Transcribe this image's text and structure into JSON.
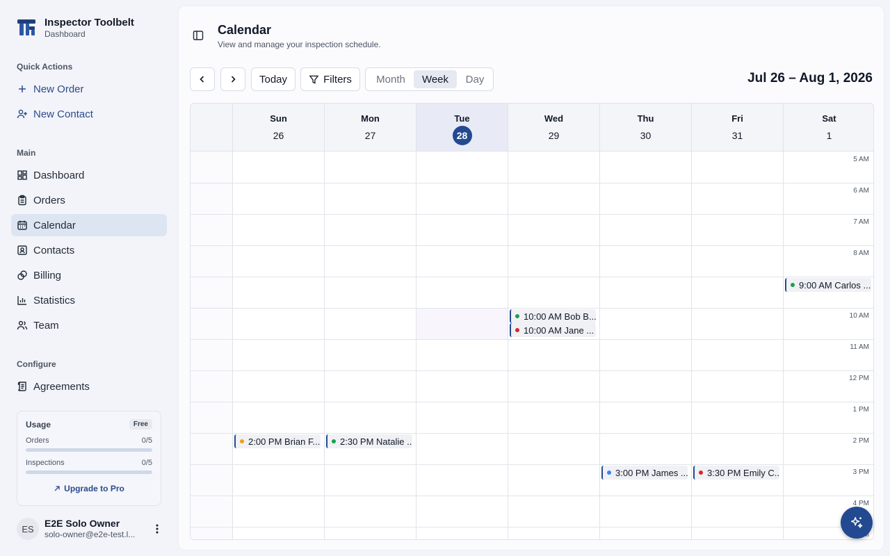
{
  "app": {
    "name": "Inspector Toolbelt",
    "subtitle": "Dashboard"
  },
  "sidebar": {
    "quick_actions_label": "Quick Actions",
    "quick_actions": [
      {
        "label": "New Order",
        "icon": "plus-icon"
      },
      {
        "label": "New Contact",
        "icon": "user-plus-icon"
      }
    ],
    "main_label": "Main",
    "main_items": [
      {
        "label": "Dashboard",
        "icon": "dashboard-icon"
      },
      {
        "label": "Orders",
        "icon": "clipboard-icon"
      },
      {
        "label": "Calendar",
        "icon": "calendar-icon",
        "active": true
      },
      {
        "label": "Contacts",
        "icon": "contact-card-icon"
      },
      {
        "label": "Billing",
        "icon": "coins-icon"
      },
      {
        "label": "Statistics",
        "icon": "bar-chart-icon"
      },
      {
        "label": "Team",
        "icon": "team-icon"
      }
    ],
    "configure_label": "Configure",
    "configure_items": [
      {
        "label": "Agreements",
        "icon": "scroll-icon"
      }
    ],
    "usage": {
      "title": "Usage",
      "plan": "Free",
      "meters": [
        {
          "label": "Orders",
          "value": "0/5",
          "fraction": 0
        },
        {
          "label": "Inspections",
          "value": "0/5",
          "fraction": 0
        }
      ],
      "upgrade_label": "Upgrade to Pro"
    },
    "user": {
      "initials": "ES",
      "name": "E2E Solo Owner",
      "email": "solo-owner@e2e-test.l..."
    }
  },
  "page": {
    "title": "Calendar",
    "subtitle": "View and manage your inspection schedule."
  },
  "toolbar": {
    "today_label": "Today",
    "filters_label": "Filters",
    "views": [
      "Month",
      "Week",
      "Day"
    ],
    "active_view": "Week",
    "range_label": "Jul 26 – Aug 1, 2026"
  },
  "calendar": {
    "days": [
      {
        "dow": "Sun",
        "date": "26"
      },
      {
        "dow": "Mon",
        "date": "27"
      },
      {
        "dow": "Tue",
        "date": "28",
        "today": true
      },
      {
        "dow": "Wed",
        "date": "29"
      },
      {
        "dow": "Thu",
        "date": "30"
      },
      {
        "dow": "Fri",
        "date": "31"
      },
      {
        "dow": "Sat",
        "date": "1"
      }
    ],
    "hours": [
      "5 AM",
      "6 AM",
      "7 AM",
      "8 AM",
      "9 AM",
      "10 AM",
      "11 AM",
      "12 PM",
      "1 PM",
      "2 PM",
      "3 PM",
      "4 PM",
      "5 PM"
    ],
    "now": {
      "day_index": 2,
      "hour_index": 5
    },
    "events": [
      {
        "day_index": 6,
        "hour_index": 4,
        "stack": 0,
        "label": "9:00 AM Carlos ...",
        "status_color": "#16a34a"
      },
      {
        "day_index": 3,
        "hour_index": 5,
        "stack": 0,
        "label": "10:00 AM Bob B...",
        "status_color": "#16a34a"
      },
      {
        "day_index": 3,
        "hour_index": 5,
        "stack": 1,
        "label": "10:00 AM Jane ...",
        "status_color": "#dc2626"
      },
      {
        "day_index": 0,
        "hour_index": 9,
        "stack": 0,
        "label": "2:00 PM Brian F...",
        "status_color": "#f59e0b"
      },
      {
        "day_index": 1,
        "hour_index": 9,
        "stack": 0,
        "label": "2:30 PM Natalie ...",
        "status_color": "#16a34a"
      },
      {
        "day_index": 4,
        "hour_index": 10,
        "stack": 0,
        "label": "3:00 PM James ...",
        "status_color": "#3b82f6"
      },
      {
        "day_index": 5,
        "hour_index": 10,
        "stack": 0,
        "label": "3:30 PM Emily C...",
        "status_color": "#dc2626"
      }
    ]
  },
  "colors": {
    "accent": "#234a90",
    "link": "#2b4c8c",
    "active_nav": "#dde5f3"
  }
}
